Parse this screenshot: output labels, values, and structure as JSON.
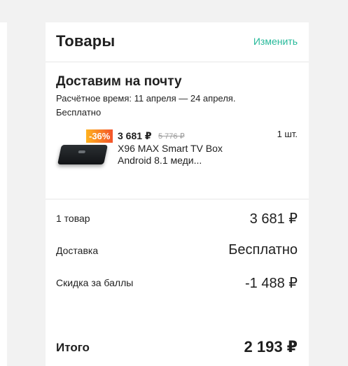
{
  "cart": {
    "title": "Товары",
    "edit_label": "Изменить"
  },
  "delivery": {
    "title": "Доставим на почту",
    "estimate": "Расчётное время: 11 апреля — 24 апреля.",
    "cost": "Бесплатно"
  },
  "product": {
    "discount": "-36%",
    "price": "3 681 ₽",
    "old_price": "5 776 ₽",
    "quantity": "1 шт.",
    "name": "X96 MAX Smart TV Box Android 8.1 меди..."
  },
  "summary": {
    "items_label": "1 товар",
    "items_value": "3 681 ₽",
    "delivery_label": "Доставка",
    "delivery_value": "Бесплатно",
    "points_label": "Скидка за баллы",
    "points_value": "-1 488 ₽",
    "total_label": "Итого",
    "total_value": "2 193 ₽"
  },
  "colors": {
    "accent": "#26b99a",
    "discount_start": "#ffb21f",
    "discount_end": "#f3532a"
  }
}
